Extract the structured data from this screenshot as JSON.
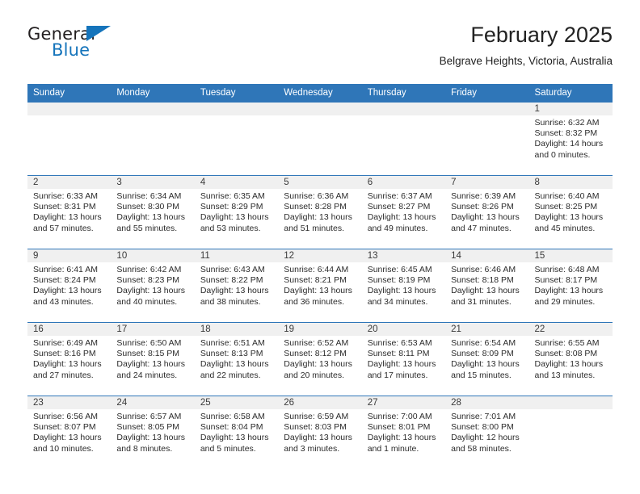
{
  "brand": {
    "word_one": "General",
    "word_two": "Blue",
    "logo_icon": "triangle-logo-icon",
    "accent_color": "#1574bb"
  },
  "header": {
    "title": "February 2025",
    "subtitle": "Belgrave Heights, Victoria, Australia",
    "header_bg_color": "#2f76b8"
  },
  "calendar": {
    "weekday_headers": [
      "Sunday",
      "Monday",
      "Tuesday",
      "Wednesday",
      "Thursday",
      "Friday",
      "Saturday"
    ],
    "weeks": [
      [
        {
          "day": "",
          "empty": true,
          "sunrise": "",
          "sunset": "",
          "daylight_1": "",
          "daylight_2": ""
        },
        {
          "day": "",
          "empty": true,
          "sunrise": "",
          "sunset": "",
          "daylight_1": "",
          "daylight_2": ""
        },
        {
          "day": "",
          "empty": true,
          "sunrise": "",
          "sunset": "",
          "daylight_1": "",
          "daylight_2": ""
        },
        {
          "day": "",
          "empty": true,
          "sunrise": "",
          "sunset": "",
          "daylight_1": "",
          "daylight_2": ""
        },
        {
          "day": "",
          "empty": true,
          "sunrise": "",
          "sunset": "",
          "daylight_1": "",
          "daylight_2": ""
        },
        {
          "day": "",
          "empty": true,
          "sunrise": "",
          "sunset": "",
          "daylight_1": "",
          "daylight_2": ""
        },
        {
          "day": "1",
          "empty": false,
          "sunrise": "Sunrise: 6:32 AM",
          "sunset": "Sunset: 8:32 PM",
          "daylight_1": "Daylight: 14 hours",
          "daylight_2": "and 0 minutes."
        }
      ],
      [
        {
          "day": "2",
          "empty": false,
          "sunrise": "Sunrise: 6:33 AM",
          "sunset": "Sunset: 8:31 PM",
          "daylight_1": "Daylight: 13 hours",
          "daylight_2": "and 57 minutes."
        },
        {
          "day": "3",
          "empty": false,
          "sunrise": "Sunrise: 6:34 AM",
          "sunset": "Sunset: 8:30 PM",
          "daylight_1": "Daylight: 13 hours",
          "daylight_2": "and 55 minutes."
        },
        {
          "day": "4",
          "empty": false,
          "sunrise": "Sunrise: 6:35 AM",
          "sunset": "Sunset: 8:29 PM",
          "daylight_1": "Daylight: 13 hours",
          "daylight_2": "and 53 minutes."
        },
        {
          "day": "5",
          "empty": false,
          "sunrise": "Sunrise: 6:36 AM",
          "sunset": "Sunset: 8:28 PM",
          "daylight_1": "Daylight: 13 hours",
          "daylight_2": "and 51 minutes."
        },
        {
          "day": "6",
          "empty": false,
          "sunrise": "Sunrise: 6:37 AM",
          "sunset": "Sunset: 8:27 PM",
          "daylight_1": "Daylight: 13 hours",
          "daylight_2": "and 49 minutes."
        },
        {
          "day": "7",
          "empty": false,
          "sunrise": "Sunrise: 6:39 AM",
          "sunset": "Sunset: 8:26 PM",
          "daylight_1": "Daylight: 13 hours",
          "daylight_2": "and 47 minutes."
        },
        {
          "day": "8",
          "empty": false,
          "sunrise": "Sunrise: 6:40 AM",
          "sunset": "Sunset: 8:25 PM",
          "daylight_1": "Daylight: 13 hours",
          "daylight_2": "and 45 minutes."
        }
      ],
      [
        {
          "day": "9",
          "empty": false,
          "sunrise": "Sunrise: 6:41 AM",
          "sunset": "Sunset: 8:24 PM",
          "daylight_1": "Daylight: 13 hours",
          "daylight_2": "and 43 minutes."
        },
        {
          "day": "10",
          "empty": false,
          "sunrise": "Sunrise: 6:42 AM",
          "sunset": "Sunset: 8:23 PM",
          "daylight_1": "Daylight: 13 hours",
          "daylight_2": "and 40 minutes."
        },
        {
          "day": "11",
          "empty": false,
          "sunrise": "Sunrise: 6:43 AM",
          "sunset": "Sunset: 8:22 PM",
          "daylight_1": "Daylight: 13 hours",
          "daylight_2": "and 38 minutes."
        },
        {
          "day": "12",
          "empty": false,
          "sunrise": "Sunrise: 6:44 AM",
          "sunset": "Sunset: 8:21 PM",
          "daylight_1": "Daylight: 13 hours",
          "daylight_2": "and 36 minutes."
        },
        {
          "day": "13",
          "empty": false,
          "sunrise": "Sunrise: 6:45 AM",
          "sunset": "Sunset: 8:19 PM",
          "daylight_1": "Daylight: 13 hours",
          "daylight_2": "and 34 minutes."
        },
        {
          "day": "14",
          "empty": false,
          "sunrise": "Sunrise: 6:46 AM",
          "sunset": "Sunset: 8:18 PM",
          "daylight_1": "Daylight: 13 hours",
          "daylight_2": "and 31 minutes."
        },
        {
          "day": "15",
          "empty": false,
          "sunrise": "Sunrise: 6:48 AM",
          "sunset": "Sunset: 8:17 PM",
          "daylight_1": "Daylight: 13 hours",
          "daylight_2": "and 29 minutes."
        }
      ],
      [
        {
          "day": "16",
          "empty": false,
          "sunrise": "Sunrise: 6:49 AM",
          "sunset": "Sunset: 8:16 PM",
          "daylight_1": "Daylight: 13 hours",
          "daylight_2": "and 27 minutes."
        },
        {
          "day": "17",
          "empty": false,
          "sunrise": "Sunrise: 6:50 AM",
          "sunset": "Sunset: 8:15 PM",
          "daylight_1": "Daylight: 13 hours",
          "daylight_2": "and 24 minutes."
        },
        {
          "day": "18",
          "empty": false,
          "sunrise": "Sunrise: 6:51 AM",
          "sunset": "Sunset: 8:13 PM",
          "daylight_1": "Daylight: 13 hours",
          "daylight_2": "and 22 minutes."
        },
        {
          "day": "19",
          "empty": false,
          "sunrise": "Sunrise: 6:52 AM",
          "sunset": "Sunset: 8:12 PM",
          "daylight_1": "Daylight: 13 hours",
          "daylight_2": "and 20 minutes."
        },
        {
          "day": "20",
          "empty": false,
          "sunrise": "Sunrise: 6:53 AM",
          "sunset": "Sunset: 8:11 PM",
          "daylight_1": "Daylight: 13 hours",
          "daylight_2": "and 17 minutes."
        },
        {
          "day": "21",
          "empty": false,
          "sunrise": "Sunrise: 6:54 AM",
          "sunset": "Sunset: 8:09 PM",
          "daylight_1": "Daylight: 13 hours",
          "daylight_2": "and 15 minutes."
        },
        {
          "day": "22",
          "empty": false,
          "sunrise": "Sunrise: 6:55 AM",
          "sunset": "Sunset: 8:08 PM",
          "daylight_1": "Daylight: 13 hours",
          "daylight_2": "and 13 minutes."
        }
      ],
      [
        {
          "day": "23",
          "empty": false,
          "sunrise": "Sunrise: 6:56 AM",
          "sunset": "Sunset: 8:07 PM",
          "daylight_1": "Daylight: 13 hours",
          "daylight_2": "and 10 minutes."
        },
        {
          "day": "24",
          "empty": false,
          "sunrise": "Sunrise: 6:57 AM",
          "sunset": "Sunset: 8:05 PM",
          "daylight_1": "Daylight: 13 hours",
          "daylight_2": "and 8 minutes."
        },
        {
          "day": "25",
          "empty": false,
          "sunrise": "Sunrise: 6:58 AM",
          "sunset": "Sunset: 8:04 PM",
          "daylight_1": "Daylight: 13 hours",
          "daylight_2": "and 5 minutes."
        },
        {
          "day": "26",
          "empty": false,
          "sunrise": "Sunrise: 6:59 AM",
          "sunset": "Sunset: 8:03 PM",
          "daylight_1": "Daylight: 13 hours",
          "daylight_2": "and 3 minutes."
        },
        {
          "day": "27",
          "empty": false,
          "sunrise": "Sunrise: 7:00 AM",
          "sunset": "Sunset: 8:01 PM",
          "daylight_1": "Daylight: 13 hours",
          "daylight_2": "and 1 minute."
        },
        {
          "day": "28",
          "empty": false,
          "sunrise": "Sunrise: 7:01 AM",
          "sunset": "Sunset: 8:00 PM",
          "daylight_1": "Daylight: 12 hours",
          "daylight_2": "and 58 minutes."
        },
        {
          "day": "",
          "empty": true,
          "sunrise": "",
          "sunset": "",
          "daylight_1": "",
          "daylight_2": ""
        }
      ]
    ]
  }
}
